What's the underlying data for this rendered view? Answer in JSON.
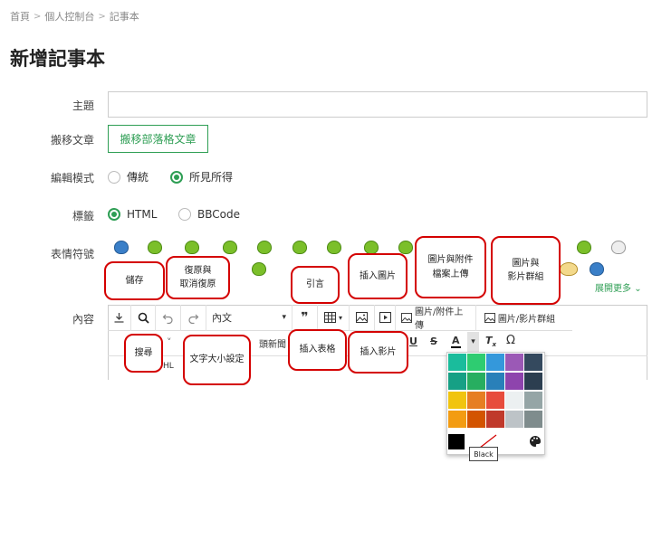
{
  "breadcrumb": {
    "home": "首頁",
    "dashboard": "個人控制台",
    "notebook": "記事本",
    "sep": ">"
  },
  "page_title": "新增記事本",
  "form": {
    "subject_label": "主題",
    "subject_value": "",
    "move_label": "搬移文章",
    "move_button": "搬移部落格文章",
    "mode_label": "編輯模式",
    "mode_traditional": "傳統",
    "mode_wysiwyg": "所見所得",
    "tag_label": "標籤",
    "tag_html": "HTML",
    "tag_bbcode": "BBCode",
    "emoji_label": "表情符號",
    "expand_more": "展開更多",
    "content_label": "內容"
  },
  "toolbar": {
    "font_size_select": "內文",
    "upload_files_label": "圖片/附件上傳",
    "image_group_label": "圖片/影片群組",
    "partial_text": "頭新聞",
    "partial_text_2": "HL",
    "partial_chevron": "˅",
    "symbol_omega": "Ω"
  },
  "callouts": {
    "save": "儲存",
    "undo_redo_line1": "復原與",
    "undo_redo_line2": "取消復原",
    "quote": "引言",
    "insert_image": "插入圖片",
    "image_attach_line1": "圖片與附件",
    "image_attach_line2": "檔案上傳",
    "image_video_line1": "圖片與",
    "image_video_line2": "影片群組",
    "search": "搜尋",
    "font_size_line1": "文字大小設定",
    "insert_table": "插入表格",
    "insert_video": "插入影片"
  },
  "color_palette": {
    "tooltip": "Black",
    "swatches": [
      "#1abc9c",
      "#2ecc71",
      "#3498db",
      "#9b59b6",
      "#34495e",
      "#16a085",
      "#27ae60",
      "#2980b9",
      "#8e44ad",
      "#2c3e50",
      "#f1c40f",
      "#e67e22",
      "#e74c3c",
      "#ecf0f1",
      "#95a5a6",
      "#f39c12",
      "#d35400",
      "#c0392b",
      "#bdc3c7",
      "#7f8c8d"
    ]
  },
  "colors": {
    "accent": "#2e9e54",
    "callout_border": "#d40000"
  }
}
